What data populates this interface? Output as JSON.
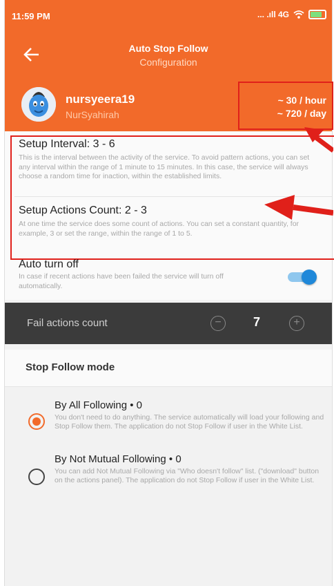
{
  "status_bar": {
    "time": "11:59 PM",
    "signal_text": "... .ıll 4G",
    "battery_color": "#7ee07e"
  },
  "app_bar": {
    "title": "Auto Stop Follow",
    "subtitle": "Configuration",
    "back_icon": "arrow-left-icon",
    "color": "#f26a2a"
  },
  "profile": {
    "username": "nursyeera19",
    "full_name": "NurSyahirah",
    "rate_hour": "~ 30 / hour",
    "rate_day": "~ 720 / day"
  },
  "setup": {
    "interval_title": "Setup Interval: 3 - 6",
    "interval_desc": "This is the interval between the activity of the service. To avoid pattern actions, you can set any interval within the range of 1 minute to 15 minutes. In this case, the service will always choose a random time for inaction, within the established limits.",
    "actions_title": "Setup Actions Count: 2 - 3",
    "actions_desc": "At one time the service does some count of actions. You can set a constant quantity, for example, 3 or set the range, within the range of 1 to 5."
  },
  "auto_turn_off": {
    "title": "Auto turn off",
    "desc": "In case if recent actions have been failed the service will turn off automatically.",
    "enabled": true
  },
  "fail_actions": {
    "label": "Fail actions count",
    "value": "7",
    "minus_symbol": "−",
    "plus_symbol": "+"
  },
  "stop_follow_mode": {
    "title": "Stop Follow mode",
    "options": [
      {
        "title": "By All Following • 0",
        "desc": "You don't need to do anything. The service automatically will load your following and Stop Follow them. The application do not Stop Follow if user in the White List.",
        "selected": true
      },
      {
        "title": "By Not Mutual Following • 0",
        "desc": "You can add Not Mutual Following via \"Who doesn't follow\" list. (\"download\" button on the actions panel). The application do not Stop Follow if user in the White List.",
        "selected": false
      }
    ]
  },
  "colors": {
    "accent": "#f26a2a",
    "highlight": "#e0201a",
    "toggle": "#1f88d9",
    "dark_bar": "#3b3b3b"
  }
}
